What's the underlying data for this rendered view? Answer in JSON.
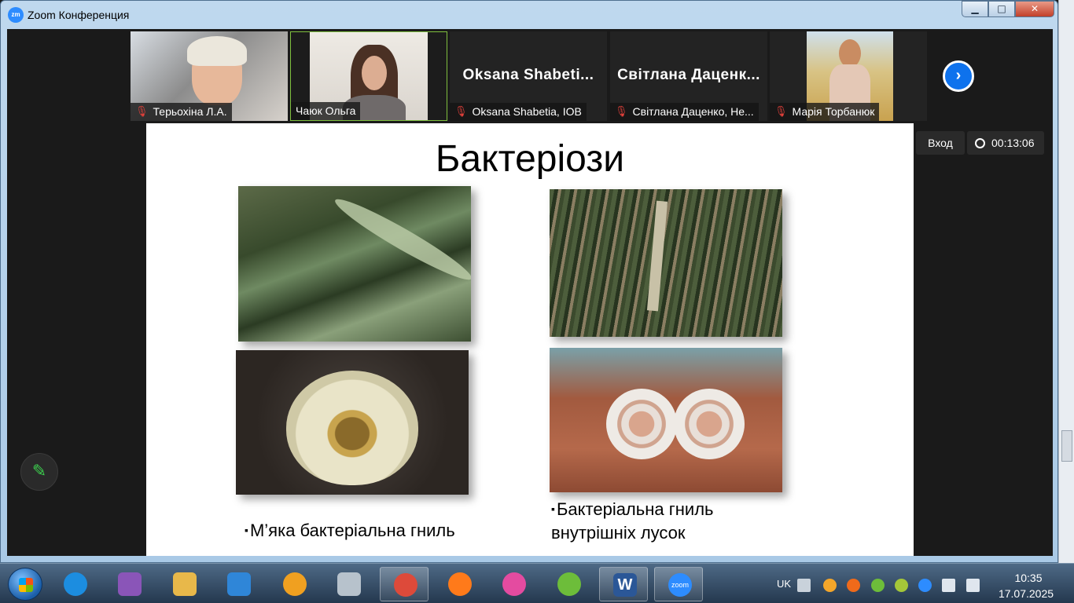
{
  "window": {
    "title": "Zoom Конференция",
    "app_logo_text": "zm",
    "controls": {
      "minimize": "▁",
      "maximize": "□",
      "close": "✕"
    }
  },
  "participants": [
    {
      "label": "Терьохіна Л.А.",
      "muted": true,
      "video": true
    },
    {
      "label": "Чаюк Ольга",
      "muted": false,
      "video": true,
      "active": true
    },
    {
      "big_name": "Oksana Shabeti...",
      "label": "Oksana Shabetia, IOB",
      "muted": true,
      "video": false
    },
    {
      "big_name": "Світлана Даценк...",
      "label": "Світлана Даценко, Не...",
      "muted": true,
      "video": false
    },
    {
      "label": "Марія Торбанюк",
      "muted": true,
      "video": true
    }
  ],
  "strip": {
    "next_label": "›"
  },
  "controls": {
    "vhod_label": "Вход",
    "timer": "00:13:06",
    "pen_icon": "✎"
  },
  "slide": {
    "title": "Бактеріози",
    "bullet": "▪",
    "caption_left": "М’яка бактеріальна гниль",
    "caption_right_line1": "Бактеріальна гниль",
    "caption_right_line2": "внутрішніх лусок"
  },
  "taskbar": {
    "apps": [
      {
        "name": "internet-explorer",
        "color": "#1c8de0",
        "open": false
      },
      {
        "name": "save-disk",
        "color": "#8a55b8",
        "open": false
      },
      {
        "name": "file-explorer",
        "color": "#e8b84a",
        "open": false
      },
      {
        "name": "media-player",
        "color": "#2f86d8",
        "open": false
      },
      {
        "name": "lock-app",
        "color": "#f0a020",
        "open": false
      },
      {
        "name": "calculator",
        "color": "#b7c2cc",
        "open": false
      },
      {
        "name": "chrome",
        "color": "#dd4a3a",
        "open": true
      },
      {
        "name": "firefox",
        "color": "#ff7a1a",
        "open": false
      },
      {
        "name": "rainbow-app",
        "color": "#e44ba0",
        "open": false
      },
      {
        "name": "utorrent",
        "color": "#6dbd3a",
        "open": false
      },
      {
        "name": "word",
        "color": "#2b5797",
        "open": true
      },
      {
        "name": "zoom",
        "color": "#2d8cff",
        "open": true
      }
    ],
    "zoom_icon_text": "zoom",
    "word_icon_text": "W",
    "language": "UK",
    "tray": [
      {
        "name": "keyboard-icon",
        "color": "#c9d2db"
      },
      {
        "name": "update-icon",
        "color": "#f4a62a"
      },
      {
        "name": "avast-icon",
        "color": "#f06a1a"
      },
      {
        "name": "utorrent-tray-icon",
        "color": "#6dbd3a"
      },
      {
        "name": "android-icon",
        "color": "#a4c639"
      },
      {
        "name": "zoom-tray-icon",
        "color": "#2d8cff"
      },
      {
        "name": "volume-muted-icon",
        "color": "#dfe6ee"
      },
      {
        "name": "network-icon",
        "color": "#dfe6ee"
      }
    ],
    "time": "10:35",
    "date": "17.07.2025"
  }
}
